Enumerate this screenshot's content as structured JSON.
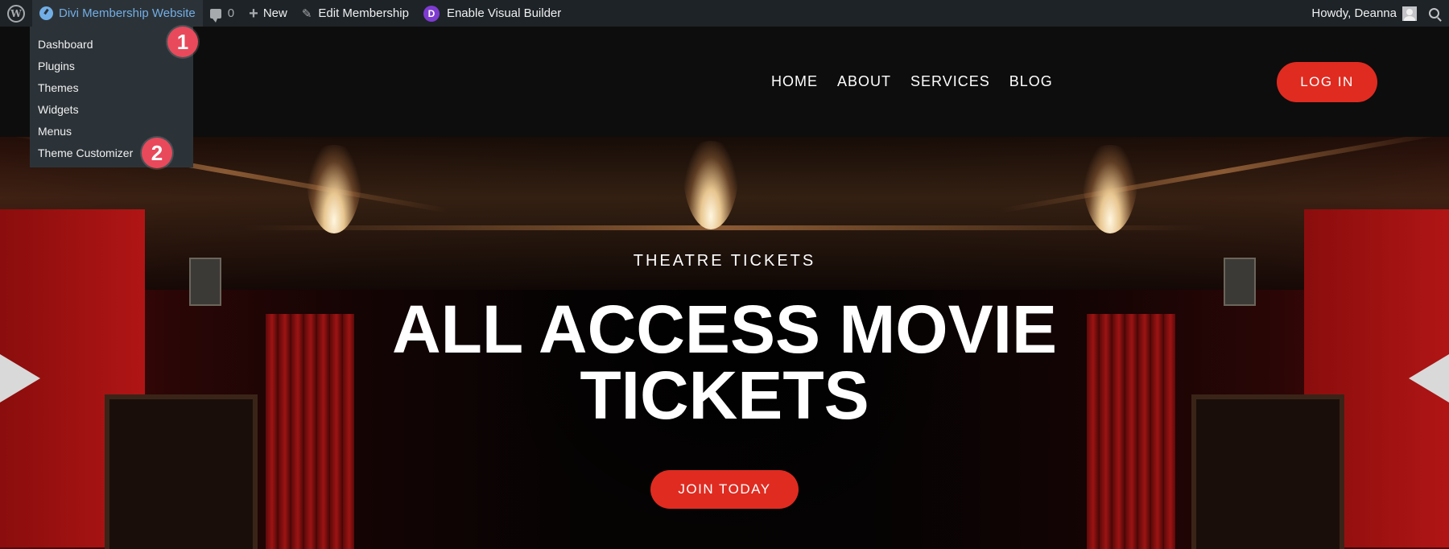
{
  "admin_bar": {
    "site_name": "Divi Membership Website",
    "comments_count": "0",
    "new_label": "New",
    "edit_label": "Edit Membership",
    "visual_builder_label": "Enable Visual Builder",
    "divi_letter": "D",
    "greeting": "Howdy, Deanna"
  },
  "dropdown": {
    "items": [
      "Dashboard",
      "Plugins",
      "Themes",
      "Widgets",
      "Menus",
      "Theme Customizer"
    ]
  },
  "markers": [
    "1",
    "2"
  ],
  "header": {
    "nav": [
      "HOME",
      "ABOUT",
      "SERVICES",
      "BLOG"
    ],
    "login_label": "LOG IN"
  },
  "hero": {
    "eyebrow": "THEATRE TICKETS",
    "title_line1": "ALL ACCESS MOVIE",
    "title_line2": "TICKETS",
    "cta_label": "JOIN TODAY"
  },
  "colors": {
    "admin_bar_bg": "#1d2327",
    "link_blue": "#72aee6",
    "accent_red": "#e02b20",
    "marker_red": "#e8495b",
    "divi_purple": "#7e3bd0"
  },
  "icons": [
    "wordpress-logo-icon",
    "dashboard-gauge-icon",
    "comment-bubble-icon",
    "plus-icon",
    "pencil-icon",
    "divi-icon",
    "avatar-icon",
    "search-icon"
  ]
}
